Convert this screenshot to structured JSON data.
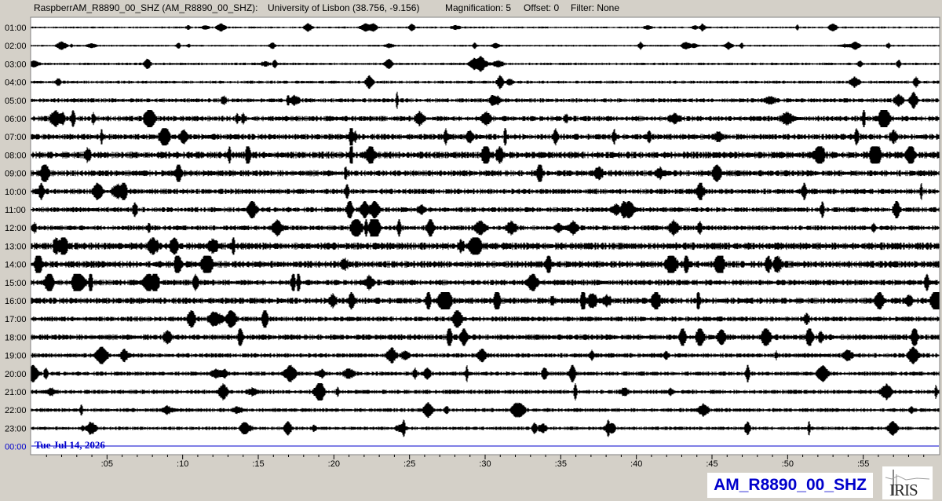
{
  "header": {
    "station": "RaspberrAM_R8890_00_SHZ (AM_R8890_00_SHZ):",
    "location": "University of Lisbon (38.756, -9.156)",
    "magnification": "Magnification: 5",
    "offset": "Offset: 0",
    "filter": "Filter: None"
  },
  "date_label": "Tue Jul 14, 2026",
  "channel_label": "AM_R8890_00_SHZ",
  "logo_text": "IRIS",
  "colors": {
    "background": "#d4d0c8",
    "plot_background": "#ffffff",
    "trace": "#000000",
    "date_line": "#0000cc",
    "date_text": "#0000cc",
    "channel_label": "#0000cc"
  },
  "chart_data": {
    "type": "line",
    "title": "",
    "xlabel": "",
    "ylabel": "",
    "row_labels": [
      "01:00",
      "02:00",
      "03:00",
      "04:00",
      "05:00",
      "06:00",
      "07:00",
      "08:00",
      "09:00",
      "10:00",
      "11:00",
      "12:00",
      "13:00",
      "14:00",
      "15:00",
      "16:00",
      "17:00",
      "18:00",
      "19:00",
      "20:00",
      "21:00",
      "22:00",
      "23:00",
      "00:00"
    ],
    "x_tick_labels": [
      ":05",
      ":10",
      ":15",
      ":20",
      ":25",
      ":30",
      ":35",
      ":40",
      ":45",
      ":50",
      ":55"
    ],
    "x_tick_minutes": [
      5,
      10,
      15,
      20,
      25,
      30,
      35,
      40,
      45,
      50,
      55
    ],
    "xlim_minutes": [
      0,
      60
    ],
    "noise_level": [
      1,
      1,
      1.3,
      1.6,
      2.2,
      2.8,
      3.0,
      3.6,
      3.2,
      2.8,
      2.6,
      2.6,
      3.8,
      3.6,
      3.0,
      3.2,
      2.6,
      3.0,
      2.4,
      2.2,
      2.2,
      2.0,
      1.8,
      0
    ],
    "grid": false,
    "legend": "none"
  }
}
